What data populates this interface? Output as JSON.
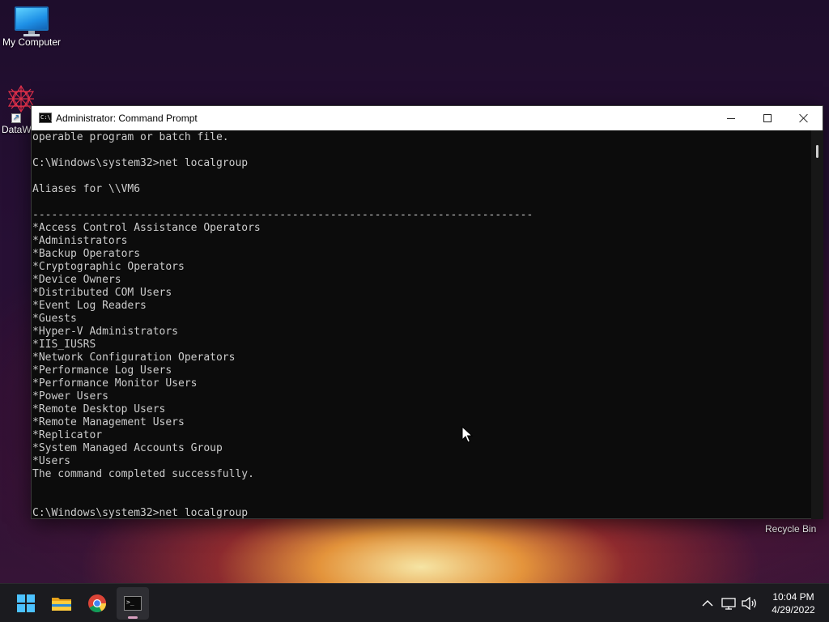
{
  "desktop": {
    "icons": [
      {
        "label": "My Computer"
      },
      {
        "label": "DataW"
      }
    ],
    "recycle_bin_label": "Recycle Bin"
  },
  "window": {
    "title": "Administrator: Command Prompt",
    "icon_text": "C:\\_"
  },
  "console_lines": [
    "operable program or batch file.",
    "",
    "C:\\Windows\\system32>net localgroup",
    "",
    "Aliases for \\\\VM6",
    "",
    "-------------------------------------------------------------------------------",
    "*Access Control Assistance Operators",
    "*Administrators",
    "*Backup Operators",
    "*Cryptographic Operators",
    "*Device Owners",
    "*Distributed COM Users",
    "*Event Log Readers",
    "*Guests",
    "*Hyper-V Administrators",
    "*IIS_IUSRS",
    "*Network Configuration Operators",
    "*Performance Log Users",
    "*Performance Monitor Users",
    "*Power Users",
    "*Remote Desktop Users",
    "*Remote Management Users",
    "*Replicator",
    "*System Managed Accounts Group",
    "*Users",
    "The command completed successfully.",
    "",
    "",
    "C:\\Windows\\system32>net localgroup"
  ],
  "taskbar": {
    "apps": [
      "start-icon",
      "file-explorer-icon",
      "chrome-icon",
      "command-prompt-icon"
    ],
    "tray_icons": [
      "chevron-up-icon",
      "network-icon",
      "volume-icon"
    ],
    "time": "10:04 PM",
    "date": "4/29/2022"
  },
  "colors": {
    "console_bg": "#0c0c0c",
    "console_text": "#cccccc",
    "taskbar_bg": "#1b1b1f",
    "windows_accent": "#4cc2ff"
  }
}
